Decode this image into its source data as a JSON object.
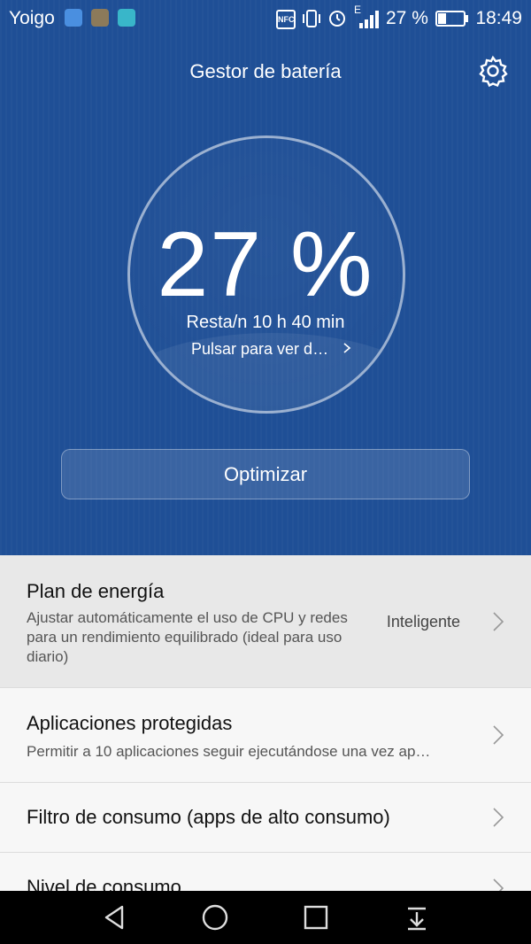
{
  "status": {
    "carrier": "Yoigo",
    "battery_percent": "27 %",
    "time": "18:49",
    "nfc": "NFC",
    "network": "E"
  },
  "header": {
    "title": "Gestor de batería"
  },
  "gauge": {
    "percent": "27 %",
    "remaining": "Resta/n 10 h 40 min",
    "details_link": "Pulsar para ver d…"
  },
  "optimize_label": "Optimizar",
  "settings": [
    {
      "title": "Plan de energía",
      "subtitle": "Ajustar automáticamente el uso de CPU y redes para un rendimiento equilibrado (ideal para uso diario)",
      "value": "Inteligente"
    },
    {
      "title": "Aplicaciones protegidas",
      "subtitle": "Permitir a 10 aplicaciones seguir ejecutándose una vez ap…"
    },
    {
      "title": "Filtro de consumo (apps de alto consumo)"
    },
    {
      "title": "Nivel de consumo"
    }
  ],
  "colors": {
    "header_bg": "#1f4f96",
    "list_bg": "#f7f7f7"
  }
}
